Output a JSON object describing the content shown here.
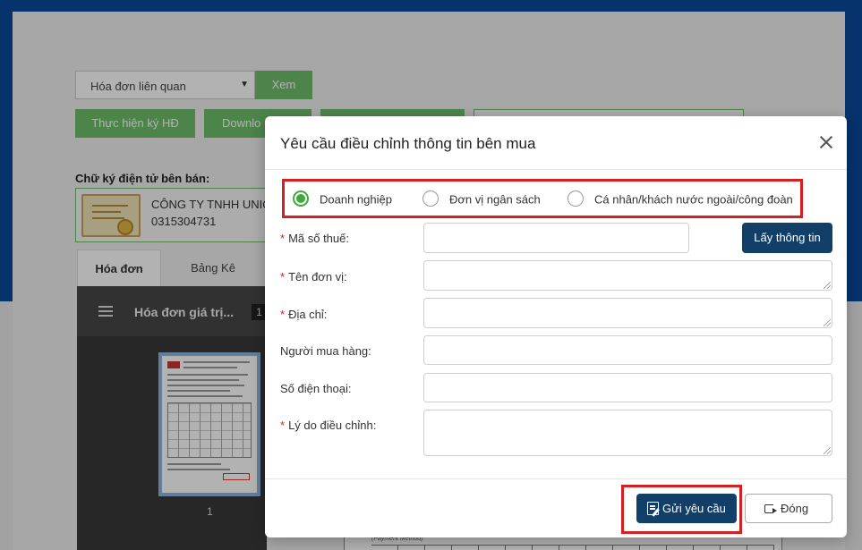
{
  "background": {
    "invoice_select": {
      "value": "Hóa đơn liên quan"
    },
    "view_button": "Xem",
    "sign_button": "Thực hiện ký HĐ",
    "download_button": "Downlo",
    "signature": {
      "title": "Chữ ký điện tử bên bán:",
      "company": "CÔNG TY TNHH UNIQ",
      "tax_code": "0315304731"
    },
    "tabs": [
      {
        "label": "Hóa đơn"
      },
      {
        "label": "Bảng Kê"
      }
    ],
    "viewer": {
      "title": "Hóa đơn giá trị...",
      "page_badge": "1",
      "thumbnail_page": "1",
      "doc_peek_text": "(Payment Method)"
    }
  },
  "modal": {
    "title": "Yêu cầu điều chỉnh thông tin bên mua",
    "buyer_types": [
      {
        "label": "Doanh nghiệp",
        "checked": true
      },
      {
        "label": "Đơn vị ngân sách",
        "checked": false
      },
      {
        "label": "Cá nhân/khách nước ngoài/công đoàn",
        "checked": false
      }
    ],
    "fields": {
      "tax_code": {
        "label": "Mã số thuế:",
        "required": "*",
        "value": ""
      },
      "unit_name": {
        "label": "Tên đơn vị:",
        "required": "*",
        "value": ""
      },
      "address": {
        "label": "Địa chỉ:",
        "required": "*",
        "value": ""
      },
      "buyer": {
        "label": "Người mua hàng:",
        "value": ""
      },
      "phone": {
        "label": "Số điện thoại:",
        "value": ""
      },
      "reason": {
        "label": "Lý do điều chỉnh:",
        "required": "*",
        "value": ""
      }
    },
    "fetch_info_button": "Lấy thông tin",
    "send_button": "Gửi yêu cầu",
    "close_button": "Đóng"
  },
  "colors": {
    "header_blue": "#0a4a9a",
    "green": "#6fbd6a",
    "primary_navy": "#123f68",
    "highlight_red": "#d42020",
    "radio_green": "#3daa3d"
  }
}
